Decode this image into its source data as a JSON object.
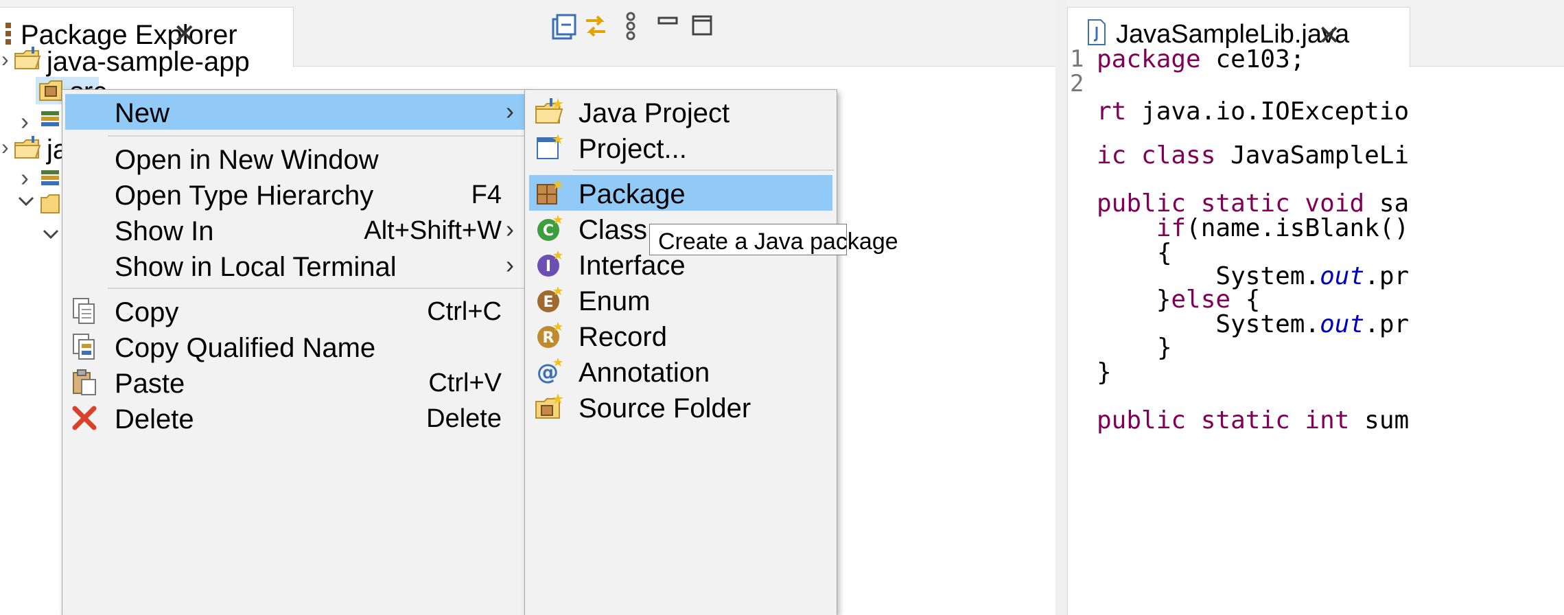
{
  "package_explorer": {
    "tab_title": "Package Explorer",
    "toolbar_icons": [
      "collapse-all-icon",
      "link-with-editor-icon",
      "view-menu-icon",
      "minimize-icon",
      "maximize-icon"
    ],
    "tree": [
      {
        "label": "java-sample-app"
      },
      {
        "label": "src"
      },
      {
        "label": "ja"
      }
    ]
  },
  "editor": {
    "tab_title": "JavaSampleLib.java",
    "lines": [
      {
        "num": "1",
        "text": "package ce103;"
      },
      {
        "num": "2",
        "text": ""
      },
      {
        "num": "",
        "text": "rt java.io.IOExceptio"
      },
      {
        "num": "",
        "text": "ic class JavaSampleLi"
      },
      {
        "num": "",
        "text": "public static void sa"
      },
      {
        "num": "",
        "text": "if(name.isBlank()"
      },
      {
        "num": "",
        "text": "{"
      },
      {
        "num": "",
        "text": "System.out.pr"
      },
      {
        "num": "",
        "text": "}else {"
      },
      {
        "num": "",
        "text": "System.out.pr"
      },
      {
        "num": "",
        "text": "}"
      },
      {
        "num": "",
        "text": "}"
      },
      {
        "num": "",
        "text": "public static int sum"
      }
    ]
  },
  "context_menu": {
    "items": [
      {
        "label": "New",
        "shortcut": "",
        "submenu": true
      },
      {
        "label": "Open in New Window",
        "shortcut": ""
      },
      {
        "label": "Open Type Hierarchy",
        "shortcut": "F4"
      },
      {
        "label": "Show In",
        "shortcut": "Alt+Shift+W",
        "submenu": true
      },
      {
        "label": "Show in Local Terminal",
        "shortcut": "",
        "submenu": true
      },
      {
        "label": "Copy",
        "shortcut": "Ctrl+C"
      },
      {
        "label": "Copy Qualified Name",
        "shortcut": ""
      },
      {
        "label": "Paste",
        "shortcut": "Ctrl+V"
      },
      {
        "label": "Delete",
        "shortcut": "Delete"
      }
    ],
    "submenu_arrow": "›"
  },
  "new_submenu": {
    "items": [
      {
        "label": "Java Project"
      },
      {
        "label": "Project..."
      },
      {
        "label": "Package"
      },
      {
        "label": "Class"
      },
      {
        "label": "Interface"
      },
      {
        "label": "Enum"
      },
      {
        "label": "Record"
      },
      {
        "label": "Annotation"
      },
      {
        "label": "Source Folder"
      }
    ]
  },
  "tooltip": {
    "text": "Create a Java package"
  },
  "colors": {
    "highlight": "#91c9f7",
    "menu_bg": "#f2f2f2",
    "keyword": "#7f0055",
    "field": "#0000c0"
  }
}
